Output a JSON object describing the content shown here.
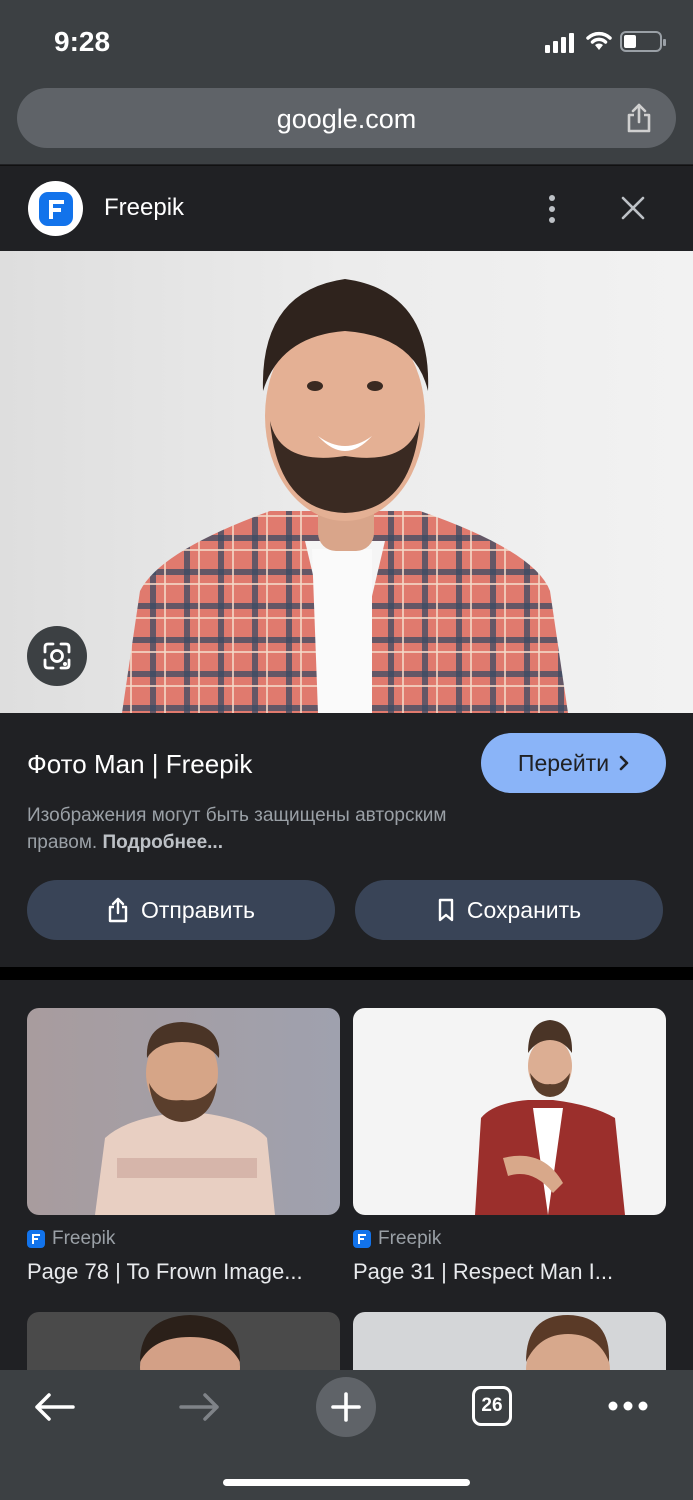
{
  "status_bar": {
    "time": "9:28"
  },
  "browser": {
    "url": "google.com",
    "tab_count": "26"
  },
  "panel": {
    "site_name": "Freepik",
    "title": "Фото Man | Freepik",
    "goto_label": "Перейти",
    "notice_text": "Изображения могут быть защищены авторским правом.",
    "notice_link": "Подробнее...",
    "share_label": "Отправить",
    "save_label": "Сохранить"
  },
  "related": [
    {
      "source": "Freepik",
      "caption": "Page 78 | To Frown Image..."
    },
    {
      "source": "Freepik",
      "caption": "Page 31 | Respect Man I..."
    }
  ],
  "colors": {
    "accent": "#8ab4f8",
    "freepik_blue": "#1273eb",
    "pill_bg": "#394457"
  }
}
